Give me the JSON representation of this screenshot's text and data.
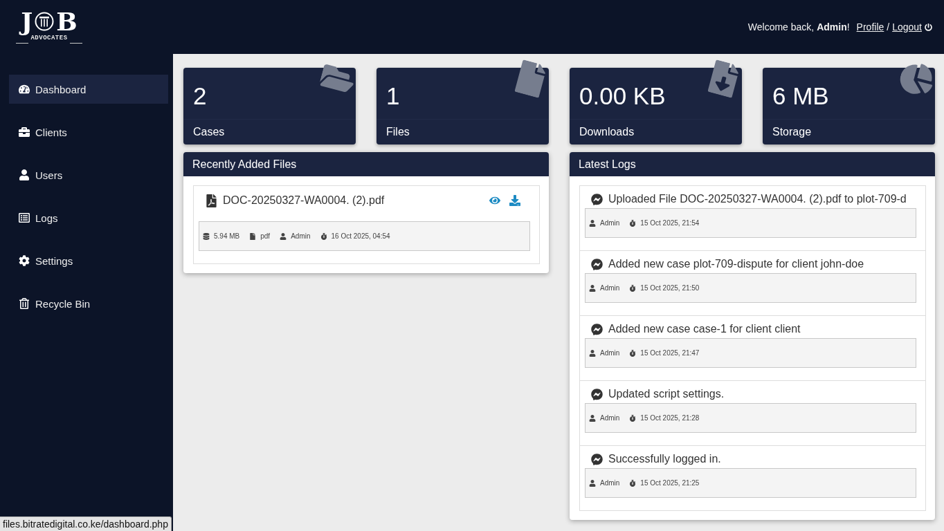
{
  "header": {
    "logo": {
      "letter_left": "J",
      "letter_right": "B",
      "subtitle": "ADVOCATES"
    },
    "welcome": "Welcome back, **Admin**!",
    "links": [
      {
        "label": "Profile"
      },
      {
        "label": "Logout"
      }
    ],
    "separator": "/"
  },
  "sidebar": {
    "items": [
      {
        "label": "Dashboard",
        "selected": true
      },
      {
        "label": "Clients",
        "selected": false
      },
      {
        "label": "Users",
        "selected": false
      },
      {
        "label": "Logs",
        "selected": false
      },
      {
        "label": "Settings",
        "selected": false
      },
      {
        "label": "Recycle Bin",
        "selected": false
      }
    ]
  },
  "stats": [
    {
      "value": "2",
      "label": "Cases"
    },
    {
      "value": "1",
      "label": "Files"
    },
    {
      "value": "0.00 KB",
      "label": "Downloads"
    },
    {
      "value": "6 MB",
      "label": "Storage"
    }
  ],
  "recent_files": {
    "title": "Recently Added Files",
    "files": [
      {
        "name": "DOC-20250327-WA0004. (2).pdf",
        "size": "5.94 MB",
        "type": "pdf",
        "user": "Admin",
        "date": "16 Oct 2025, 04:54"
      }
    ]
  },
  "latest_logs": {
    "title": "Latest Logs",
    "entries": [
      {
        "text": "Uploaded File DOC-20250327-WA0004. (2).pdf to plot-709-d",
        "user": "Admin",
        "time": "15 Oct 2025, 21:54"
      },
      {
        "text": "Added new case plot-709-dispute for client john-doe",
        "user": "Admin",
        "time": "15 Oct 2025, 21:50"
      },
      {
        "text": "Added new case case-1 for client client",
        "user": "Admin",
        "time": "15 Oct 2025, 21:47"
      },
      {
        "text": "Updated script settings.",
        "user": "Admin",
        "time": "15 Oct 2025, 21:28"
      },
      {
        "text": "Successfully logged in.",
        "user": "Admin",
        "time": "15 Oct 2025, 21:25"
      }
    ]
  },
  "status_bar": {
    "url": "files.bitratedigital.co.ke/dashboard.php"
  }
}
